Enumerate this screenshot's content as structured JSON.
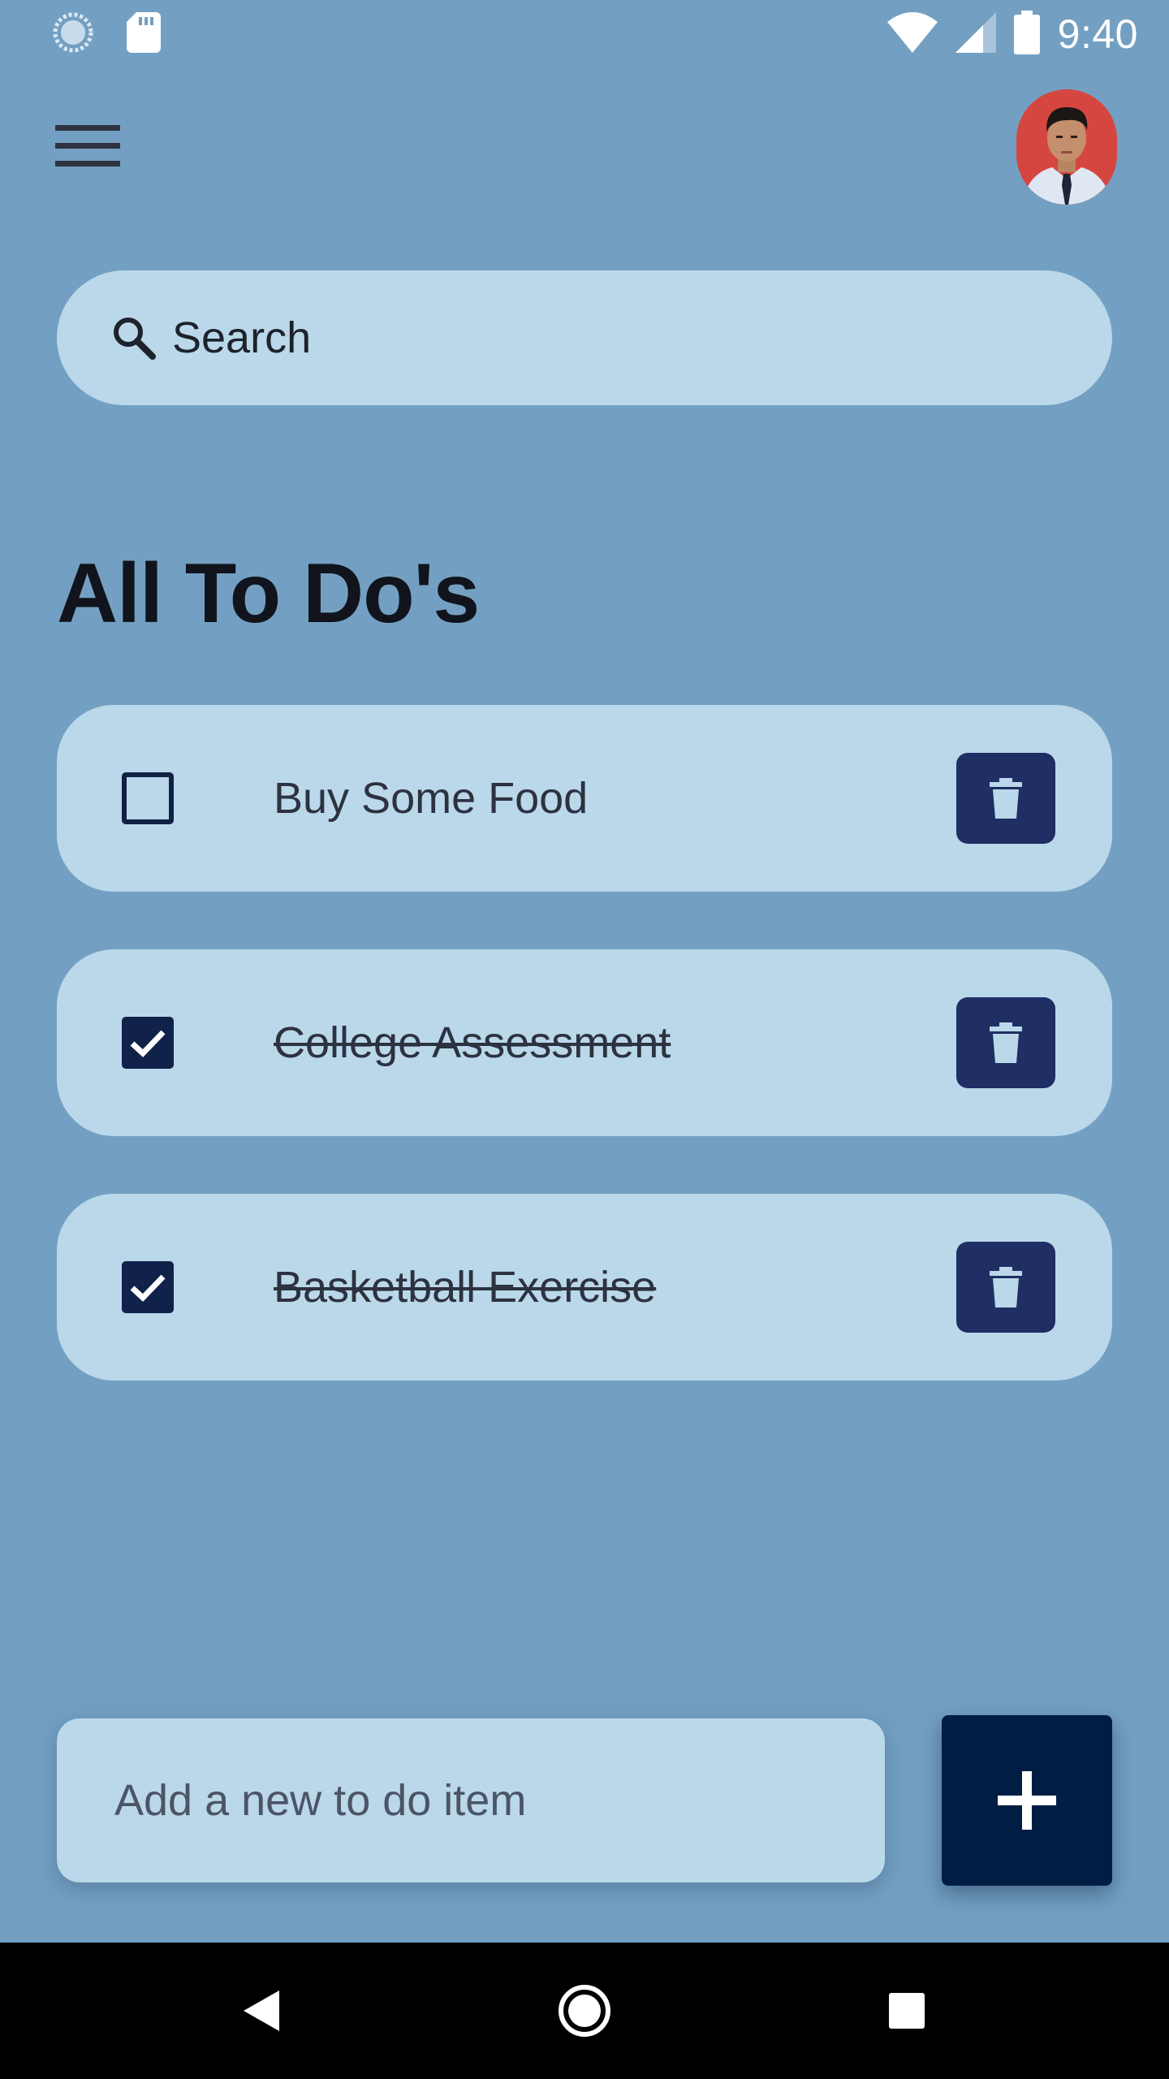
{
  "status_bar": {
    "time": "9:40",
    "icons": [
      "sync-icon",
      "sd-card-icon",
      "wifi-icon",
      "signal-icon",
      "battery-icon"
    ]
  },
  "header": {
    "menu_icon": "hamburger-menu-icon",
    "avatar": "user-avatar"
  },
  "search": {
    "placeholder": "Search",
    "icon": "search-icon"
  },
  "main": {
    "title": "All To Do's",
    "todos": [
      {
        "label": "Buy Some Food",
        "done": false
      },
      {
        "label": "College Assessment",
        "done": true
      },
      {
        "label": "Basketball Exercise",
        "done": true
      }
    ]
  },
  "add_bar": {
    "placeholder": "Add a new to do item",
    "button_icon": "plus-icon"
  },
  "nav_bar": {
    "icons": [
      "back-icon",
      "home-icon",
      "recents-icon"
    ]
  },
  "colors": {
    "background": "#73a0c2",
    "card": "#bad8ea",
    "delete_button": "#1f2e63",
    "add_button": "#001e44",
    "checkbox": "#10224a"
  }
}
